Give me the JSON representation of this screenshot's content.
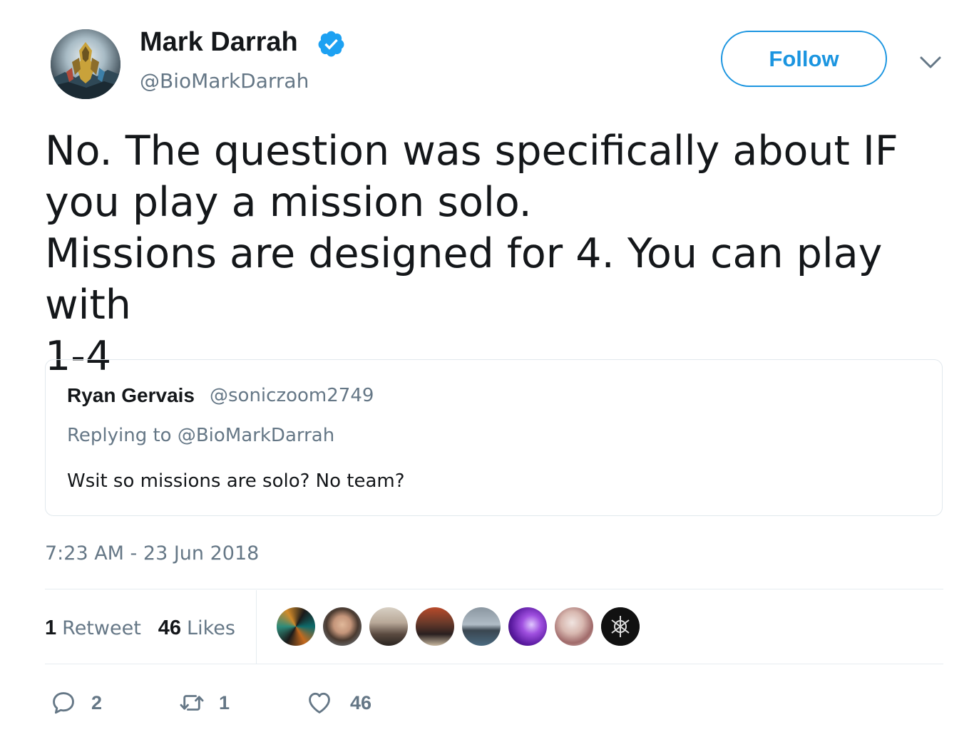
{
  "author": {
    "name": "Mark Darrah",
    "handle": "@BioMarkDarrah",
    "verified": true,
    "verified_icon": "verified-badge-icon",
    "avatar_icon": "anthem-game-art-avatar"
  },
  "header": {
    "follow_label": "Follow",
    "menu_icon": "chevron-down-icon"
  },
  "tweet": {
    "text": "No. The question was specifically about IF\nyou play a mission solo.\nMissions are designed for 4. You can play with\n1-4",
    "timestamp": "7:23 AM - 23 Jun 2018"
  },
  "quoted_tweet": {
    "name": "Ryan Gervais",
    "handle": "@soniczoom2749",
    "replying_to": "Replying to @BioMarkDarrah",
    "text": "Wsit so missions are solo? No team?"
  },
  "stats": {
    "retweets_count": "1",
    "retweets_label": "Retweet",
    "likes_count": "46",
    "likes_label": "Likes",
    "likers": [
      {
        "icon": "liker-avatar-1"
      },
      {
        "icon": "liker-avatar-2"
      },
      {
        "icon": "liker-avatar-3"
      },
      {
        "icon": "liker-avatar-4"
      },
      {
        "icon": "liker-avatar-5"
      },
      {
        "icon": "liker-avatar-6"
      },
      {
        "icon": "liker-avatar-7"
      },
      {
        "icon": "liker-avatar-8"
      }
    ]
  },
  "actions": {
    "reply": {
      "icon": "reply-icon",
      "count": "2"
    },
    "retweet": {
      "icon": "retweet-icon",
      "count": "1"
    },
    "like": {
      "icon": "heart-icon",
      "count": "46"
    }
  },
  "colors": {
    "accent": "#1b95e0",
    "verified": "#1da1f2",
    "text_primary": "#14171a",
    "text_secondary": "#657786",
    "border": "#e1e8ed"
  }
}
